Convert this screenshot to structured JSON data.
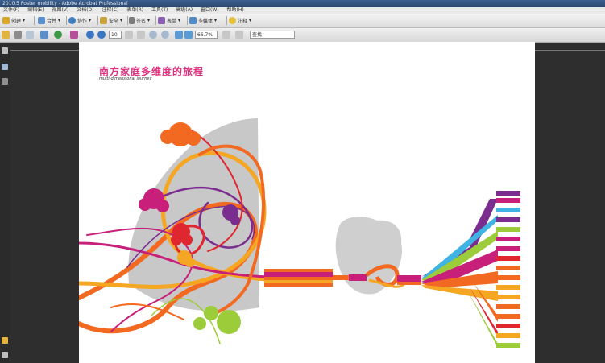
{
  "window": {
    "title": "2010.5 Poster mobility - Adobe Acrobat Professional"
  },
  "menu": [
    "文件(F)",
    "编辑(E)",
    "视图(V)",
    "文档(D)",
    "注释(C)",
    "表单(R)",
    "工具(T)",
    "高级(A)",
    "窗口(W)",
    "帮助(H)"
  ],
  "toolbar": {
    "create": "创建",
    "combine": "合并",
    "collaborate": "协作",
    "secure": "安全",
    "sign": "签名",
    "forms": "表单",
    "multimedia": "多媒体",
    "comment": "注释"
  },
  "navigation": {
    "page": "10",
    "zoom": "66.7%",
    "find": "查找"
  },
  "page": {
    "title": "南方家庭多维度的旅程",
    "subtitle": "multi-dimensional journey"
  },
  "colors": {
    "magenta": "#c8207a",
    "orange": "#f26a21",
    "amber": "#f5a623",
    "purple": "#7a2c8f",
    "lime": "#9ccc3a",
    "red": "#e0262f",
    "gray": "#c8c8c8"
  },
  "icons": [
    "create-icon",
    "combine-icon",
    "collaborate-icon",
    "secure-icon",
    "sign-icon",
    "forms-icon",
    "multimedia-icon",
    "comment-icon",
    "open-icon",
    "print-icon",
    "email-icon",
    "search-icon",
    "prev-page-icon",
    "next-page-icon",
    "hand-tool-icon",
    "select-tool-icon",
    "zoom-in-icon",
    "zoom-out-icon"
  ]
}
